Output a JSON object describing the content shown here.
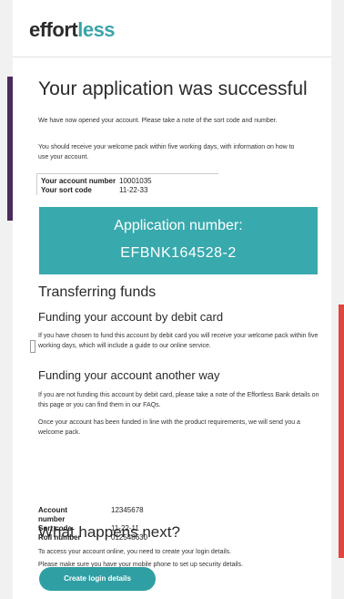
{
  "logo": {
    "part1": "effort",
    "part2": "less"
  },
  "main": {
    "title": "Your application was successful",
    "intro1": "We have now opened your account. Please take a note of the sort code and number.",
    "intro2": "You should receive your welcome pack within five working days, with information on how to use your account.",
    "account_number_label": "Your account number",
    "account_number": "10001035",
    "sort_code_label": "Your sort code",
    "sort_code": "11-22-33",
    "application_label": "Application number:",
    "application_number": "EFBNK164528-2"
  },
  "transfer": {
    "title": "Transferring funds",
    "debit_heading": "Funding your account by debit card",
    "debit_text": "If you have chosen to fund this account by debit card you will receive your welcome pack within five working days, which will include a guide to our online service.",
    "other_heading": "Funding your account another way",
    "other_text": "If you are not funding this account by debit card, please take a note of the Effortless Bank details on this page or you can find them in our FAQs.",
    "other_text2": "Once your account has been funded in line with the product requirements, we will send you a welcome pack.",
    "acct_label": "Account number",
    "acct_value": "12345678",
    "sort_label": "Sort code",
    "sort_value": "11-22-11",
    "roll_label": "Roll number",
    "roll_value": "012548630"
  },
  "next": {
    "title": "What happens next?",
    "text1": "To access your account online, you need to create your login details.",
    "text2": "Please make sure you have your mobile phone to set up security details.",
    "button": "Create login details"
  },
  "colors": {
    "teal": "#38a9ad",
    "purple_bar": "#4b2a5d",
    "red_bar": "#e0463d"
  }
}
